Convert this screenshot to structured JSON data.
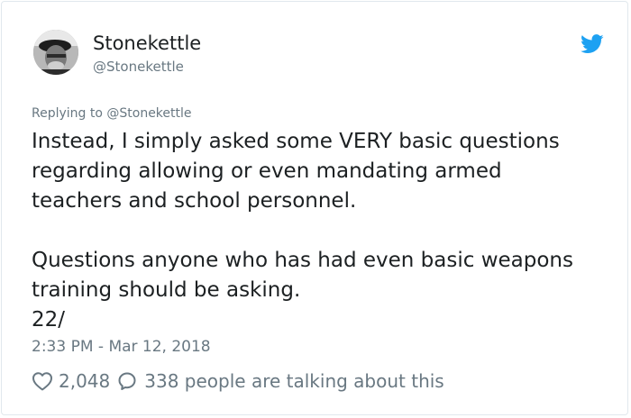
{
  "author": {
    "display_name": "Stonekettle",
    "handle": "@Stonekettle"
  },
  "tweet": {
    "reply_context": "Replying to @Stonekettle",
    "text": "Instead, I simply asked some VERY basic questions\nregarding allowing or even mandating armed\nteachers and school personnel.\n\nQuestions anyone who has had even basic weapons\ntraining should be asking.\n22/",
    "timestamp": "2:33 PM - Mar 12, 2018"
  },
  "stats": {
    "likes": "2,048",
    "conversation": "338 people are talking about this"
  },
  "icons": {
    "brand": "twitter-bird-icon",
    "like": "heart-icon",
    "comment": "speech-bubble-icon"
  },
  "colors": {
    "brand_blue": "#1da1f2",
    "text_primary": "#1c2022",
    "text_secondary": "#697882"
  }
}
